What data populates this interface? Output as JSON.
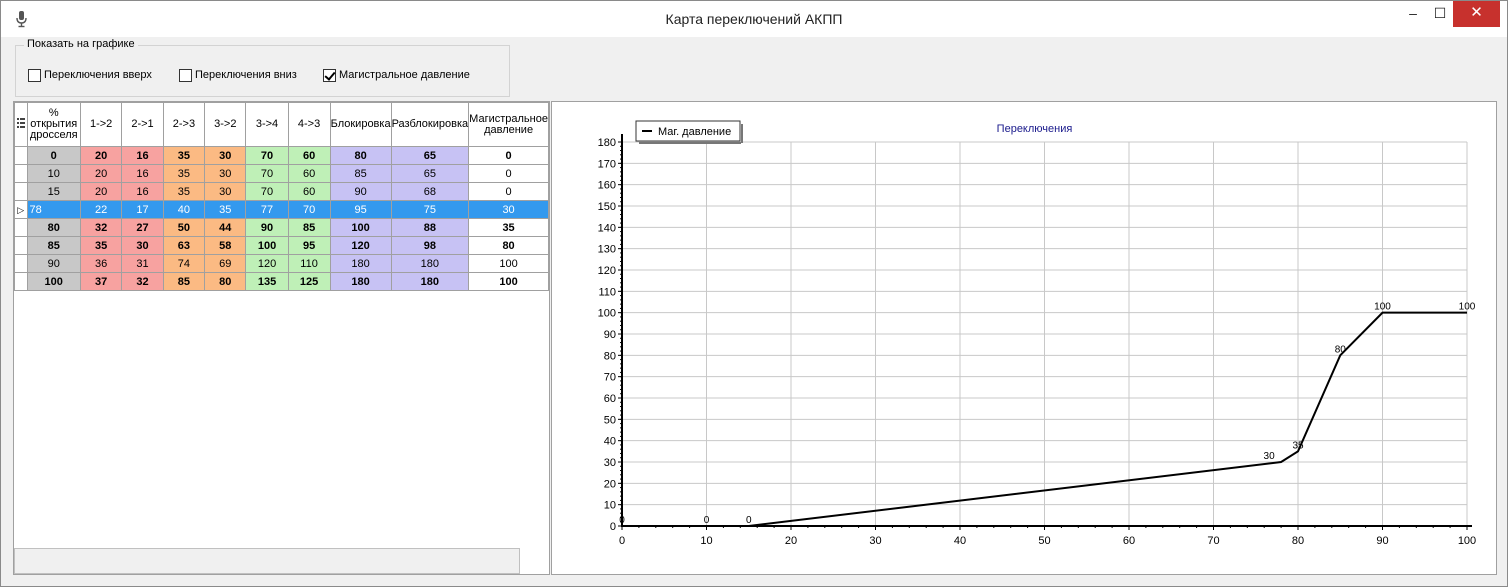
{
  "window": {
    "title": "Карта переключений АКПП",
    "minimize_glyph": "–",
    "maximize_glyph": "☐",
    "close_glyph": "✕",
    "app_icon": "microphone-icon"
  },
  "options": {
    "group_title": "Показать на графике",
    "checkboxes": [
      {
        "label": "Переключения вверх",
        "checked": false
      },
      {
        "label": "Переключения вниз",
        "checked": false
      },
      {
        "label": "Магистральное давление",
        "checked": true
      }
    ]
  },
  "grid": {
    "columns": [
      "% открытия дросселя",
      "1->2",
      "2->1",
      "2->3",
      "3->2",
      "3->4",
      "4->3",
      "Блокировка",
      "Разблокировка",
      "Магистральное давление"
    ],
    "column_colors": [
      "#c8c8c8",
      "#f7a2a0",
      "#f7a2a0",
      "#fbba83",
      "#fbba83",
      "#bff0b7",
      "#bff0b7",
      "#c7c2f4",
      "#c7c2f4",
      "#ffffff"
    ],
    "rows": [
      {
        "values": [
          "0",
          "20",
          "16",
          "35",
          "30",
          "70",
          "60",
          "80",
          "65",
          "0"
        ],
        "bold": true
      },
      {
        "values": [
          "10",
          "20",
          "16",
          "35",
          "30",
          "70",
          "60",
          "85",
          "65",
          "0"
        ],
        "bold": false
      },
      {
        "values": [
          "15",
          "20",
          "16",
          "35",
          "30",
          "70",
          "60",
          "90",
          "68",
          "0"
        ],
        "bold": false
      },
      {
        "values": [
          "78",
          "22",
          "17",
          "40",
          "35",
          "77",
          "70",
          "95",
          "75",
          "30"
        ],
        "bold": false,
        "selected": true
      },
      {
        "values": [
          "80",
          "32",
          "27",
          "50",
          "44",
          "90",
          "85",
          "100",
          "88",
          "35"
        ],
        "bold": true
      },
      {
        "values": [
          "85",
          "35",
          "30",
          "63",
          "58",
          "100",
          "95",
          "120",
          "98",
          "80"
        ],
        "bold": true
      },
      {
        "values": [
          "90",
          "36",
          "31",
          "74",
          "69",
          "120",
          "110",
          "180",
          "180",
          "100"
        ],
        "bold": false
      },
      {
        "values": [
          "100",
          "37",
          "32",
          "85",
          "80",
          "135",
          "125",
          "180",
          "180",
          "100"
        ],
        "bold": true
      }
    ],
    "row_indicator_glyph": "▷"
  },
  "chart_data": {
    "type": "line",
    "title": "Переключения",
    "xlim": [
      0,
      100
    ],
    "ylim": [
      0,
      180
    ],
    "x_ticks": [
      0,
      10,
      20,
      30,
      40,
      50,
      60,
      70,
      80,
      90,
      100
    ],
    "y_ticks": [
      0,
      10,
      20,
      30,
      40,
      50,
      60,
      70,
      80,
      90,
      100,
      110,
      120,
      130,
      140,
      150,
      160,
      170,
      180
    ],
    "grid": true,
    "legend_placement": "top-left",
    "series": [
      {
        "name": "Маг. давление",
        "color": "#000000",
        "x": [
          0,
          10,
          15,
          78,
          80,
          85,
          90,
          100
        ],
        "y": [
          0,
          0,
          0,
          30,
          35,
          80,
          100,
          100
        ],
        "labels": [
          "0",
          "0",
          "0",
          "30",
          "35",
          "80",
          "100",
          "100"
        ]
      }
    ]
  }
}
